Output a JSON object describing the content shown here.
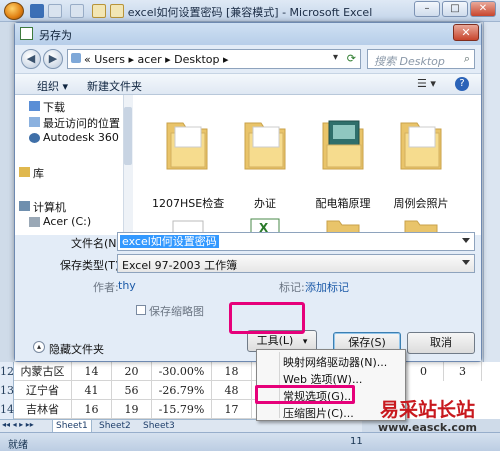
{
  "excel": {
    "title": "excel如何设置密码 [兼容模式] - Microsoft Excel",
    "window_buttons": [
      "–",
      "□",
      "✕"
    ],
    "rows": [
      {
        "num": "12",
        "cells": [
          "内蒙古区",
          "14",
          "20",
          "-30.00%",
          "18",
          "22",
          "",
          "",
          "0",
          "3"
        ]
      },
      {
        "num": "13",
        "cells": [
          "辽宁省",
          "41",
          "56",
          "-26.79%",
          "48",
          "63",
          "",
          "",
          "",
          ""
        ]
      },
      {
        "num": "14",
        "cells": [
          "吉林省",
          "16",
          "19",
          "-15.79%",
          "17",
          "21",
          "",
          "",
          "",
          ""
        ]
      }
    ],
    "sheets": [
      "Sheet1",
      "Sheet2",
      "Sheet3"
    ],
    "status_ready": "就绪",
    "zoom_fragment": "11"
  },
  "dialog": {
    "title": "另存为",
    "close_label": "✕",
    "address": "« Users  ▸  acer  ▸  Desktop  ▸",
    "search_placeholder": "搜索 Desktop",
    "organize_label": "组织 ▾",
    "new_folder_label": "新建文件夹",
    "nav_items": [
      "下载",
      "最近访问的位置",
      "Autodesk 360",
      "库",
      "计算机",
      "Acer (C:)"
    ],
    "files": [
      {
        "name": "1207HSE检查"
      },
      {
        "name": "办证"
      },
      {
        "name": "配电箱原理"
      },
      {
        "name": "周例会照片"
      }
    ],
    "filename_label": "文件名(N):",
    "filename_value": "excel如何设置密码",
    "savetype_label": "保存类型(T):",
    "savetype_value": "Excel 97-2003 工作簿",
    "author_label": "作者:",
    "author_value": "thy",
    "tags_label": "标记:",
    "tags_value": "添加标记",
    "thumbnail_label": "保存缩略图",
    "hide_folders_label": "隐藏文件夹",
    "tools_label": "工具(L)",
    "save_label": "保存(S)",
    "cancel_label": "取消",
    "tools_menu": [
      "映射网络驱动器(N)...",
      "Web 选项(W)...",
      "常规选项(G)...",
      "压缩图片(C)..."
    ]
  },
  "watermark": {
    "text": "易采站长站",
    "url": "www.easck.com"
  }
}
